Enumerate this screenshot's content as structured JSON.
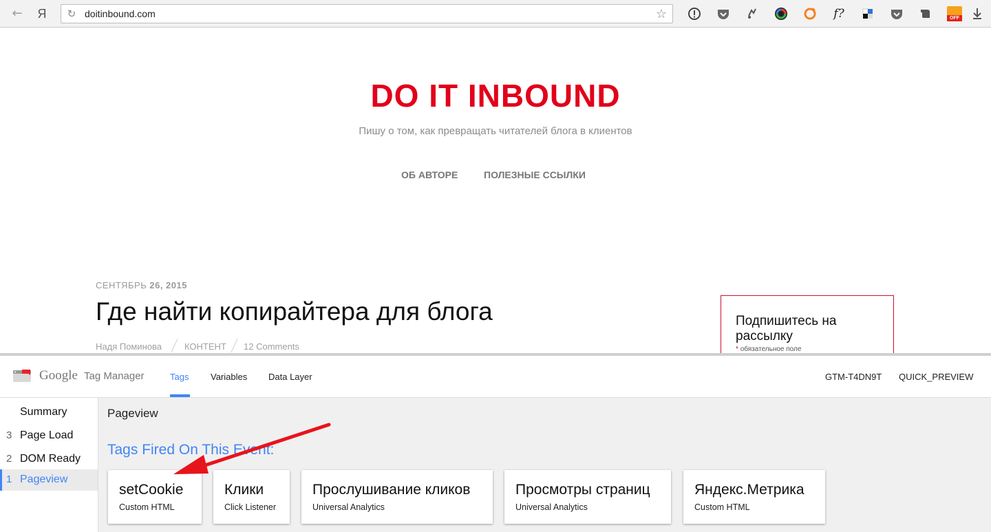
{
  "browser": {
    "url": "doitinbound.com",
    "yandex_label": "Я",
    "extensions": [
      "info-icon",
      "pocket-icon",
      "refresh-arrows-icon",
      "color-wheel-icon",
      "orange-ring-icon",
      "font-question-icon",
      "delicious-icon",
      "pocket-icon",
      "evernote-icon",
      "adblock-off-icon",
      "download-icon"
    ],
    "ext_font_question": "f?",
    "ext_off_label": "OFF"
  },
  "site": {
    "title": "DO IT INBOUND",
    "tagline": "Пишу о том, как превращать читателей блога в клиентов",
    "nav": [
      "ОБ АВТОРЕ",
      "ПОЛЕЗНЫЕ ССЫЛКИ"
    ],
    "accent": "#e2001a"
  },
  "post": {
    "date_month": "СЕНТЯБРЬ",
    "date_rest": "26, 2015",
    "title": "Где найти копирайтера для блога",
    "author": "Надя Поминова",
    "category": "КОНТЕНТ",
    "comments": "12 Comments"
  },
  "subscribe": {
    "title": "Подпишитесь на рассылку",
    "required_mark": "*",
    "required_text": "обязательное поле"
  },
  "gtm": {
    "brand_google": "Google",
    "brand_product": "Tag Manager",
    "tabs": [
      "Tags",
      "Variables",
      "Data Layer"
    ],
    "active_tab": "Tags",
    "container_id": "GTM-T4DN9T",
    "mode": "QUICK_PREVIEW",
    "accent": "#4285f4",
    "sidebar": [
      {
        "num": "",
        "label": "Summary"
      },
      {
        "num": "3",
        "label": "Page Load"
      },
      {
        "num": "2",
        "label": "DOM Ready"
      },
      {
        "num": "1",
        "label": "Pageview"
      }
    ],
    "selected_event": "Pageview",
    "event_title": "Pageview",
    "fired_heading": "Tags Fired On This Event:",
    "tags_fired": [
      {
        "name": "setCookie",
        "type": "Custom HTML"
      },
      {
        "name": "Клики",
        "type": "Click Listener"
      },
      {
        "name": "Прослушивание кликов",
        "type": "Universal Analytics"
      },
      {
        "name": "Просмотры страниц",
        "type": "Universal Analytics"
      },
      {
        "name": "Яндекс.Метрика",
        "type": "Custom HTML"
      }
    ]
  },
  "annotation": {
    "arrow_color": "#e8141c",
    "points_to": "setCookie"
  }
}
